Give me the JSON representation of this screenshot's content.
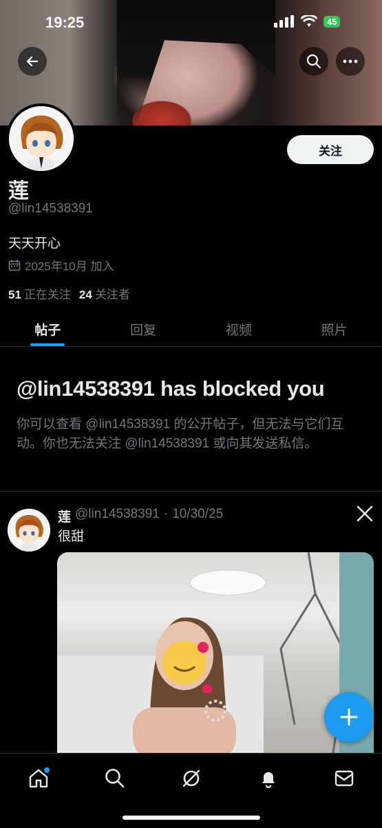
{
  "status_bar": {
    "time": "19:25",
    "battery": "45"
  },
  "profile": {
    "display_name": "莲",
    "handle": "@lin14538391",
    "bio": "天天开心",
    "joined": "2025年10月 加入",
    "following_count": "51",
    "following_label": "正在关注",
    "followers_count": "24",
    "followers_label": "关注者",
    "follow_button": "关注"
  },
  "tabs": [
    {
      "label": "帖子",
      "active": true
    },
    {
      "label": "回复",
      "active": false
    },
    {
      "label": "视频",
      "active": false
    },
    {
      "label": "照片",
      "active": false
    }
  ],
  "blocked": {
    "title": "@lin14538391 has blocked you",
    "description": "你可以查看 @lin14538391 的公开帖子，但无法与它们互动。你也无法关注 @lin14538391 或向其发送私信。"
  },
  "post": {
    "name": "莲",
    "handle": "@lin14538391",
    "separator": "·",
    "date": "10/30/25",
    "text": "很甜"
  },
  "icons": {
    "back": "back-arrow-icon",
    "search": "search-icon",
    "more": "more-icon",
    "calendar": "calendar-icon",
    "x_logo": "x-logo-icon",
    "fab": "plus-icon",
    "nav": [
      "home-icon",
      "search-icon",
      "grok-icon",
      "bell-icon",
      "mail-icon"
    ]
  },
  "colors": {
    "accent": "#1d9bf0",
    "background": "#000000",
    "secondary_text": "#71767b"
  }
}
